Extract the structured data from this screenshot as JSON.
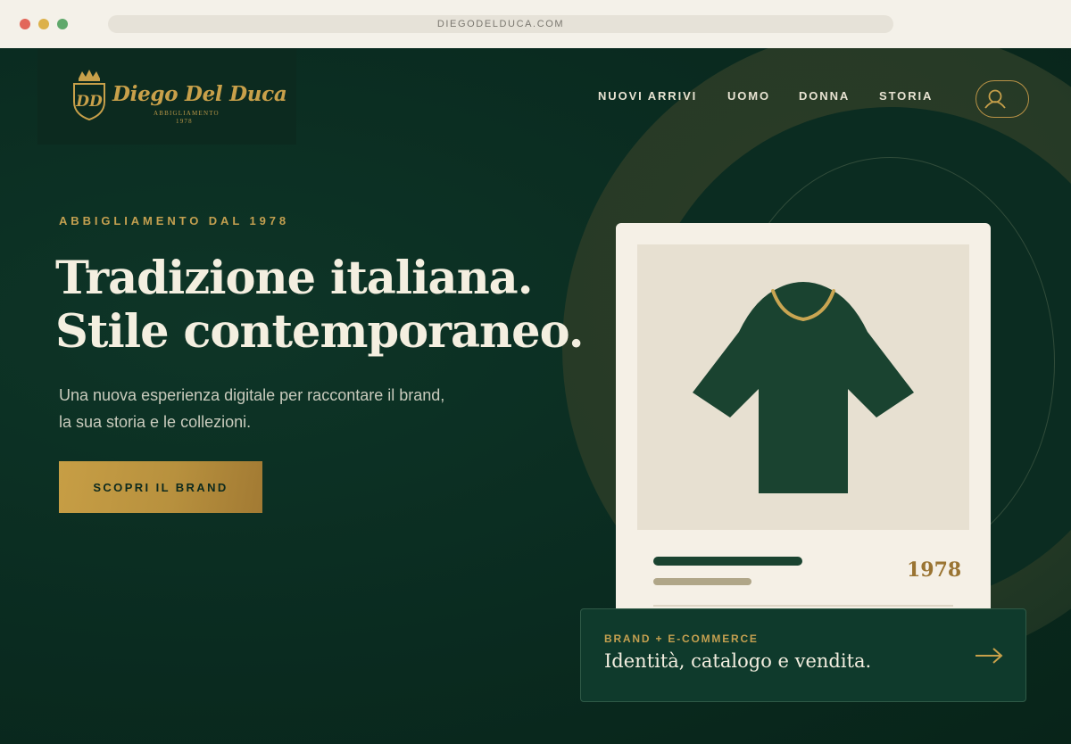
{
  "browser": {
    "url": "DIEGODELDUCA.COM"
  },
  "brand": {
    "name": "Diego Del Duca",
    "subtitle": "ABBIGLIAMENTO",
    "year": "1978",
    "monogram": "DD",
    "gold": "#c8a04a",
    "dark_green": "#0a2b20"
  },
  "nav": {
    "items": [
      "NUOVI ARRIVI",
      "UOMO",
      "DONNA",
      "STORIA"
    ],
    "account_icon": "account-icon"
  },
  "hero": {
    "eyebrow": "ABBIGLIAMENTO DAL 1978",
    "headline_line1": "Tradizione italiana.",
    "headline_line2": "Stile contemporaneo.",
    "lead_line1": "Una nuova esperienza digitale per raccontare il brand,",
    "lead_line2": "la sua storia e le collezioni.",
    "cta_label": "SCOPRI IL BRAND"
  },
  "product_card": {
    "image_icon": "tshirt-icon",
    "year": "1978"
  },
  "feature": {
    "label": "BRAND + E-COMMERCE",
    "title": "Identità, catalogo e vendita.",
    "arrow_icon": "arrow-right-icon"
  }
}
